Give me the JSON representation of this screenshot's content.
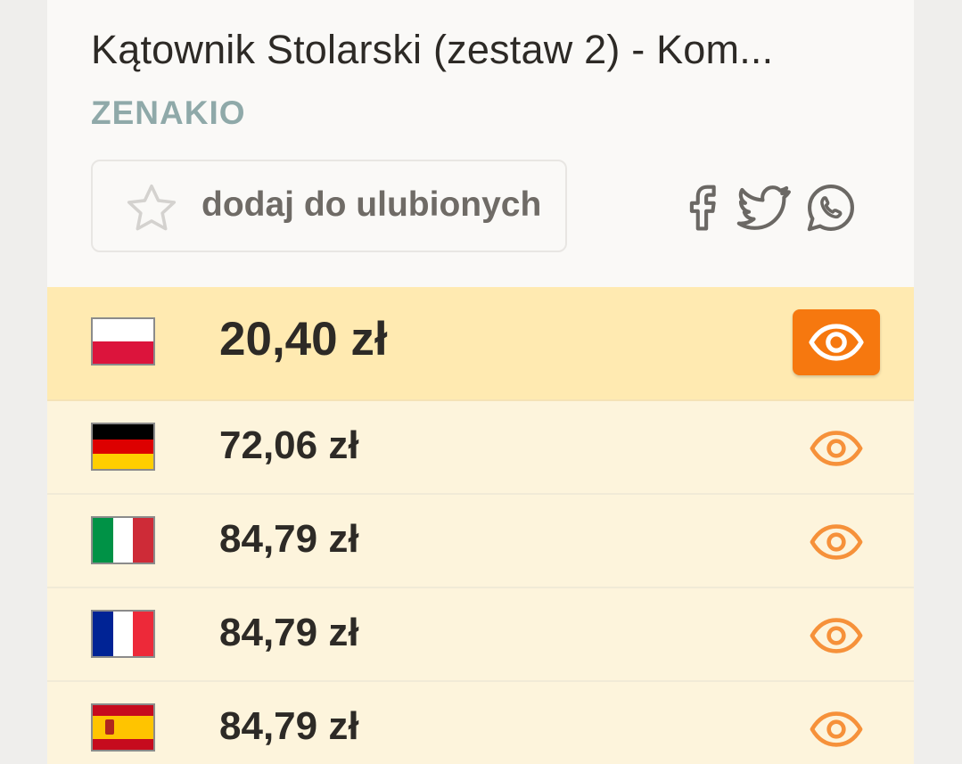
{
  "product": {
    "title": "Kątownik Stolarski (zestaw 2) - Kom...",
    "brand": "ZENAKIO"
  },
  "favorite": {
    "label": "dodaj do ulubionych",
    "icon": "star-icon"
  },
  "share": [
    {
      "icon": "facebook-icon"
    },
    {
      "icon": "twitter-icon"
    },
    {
      "icon": "whatsapp-icon"
    }
  ],
  "offers": [
    {
      "country": "Poland",
      "flag": "pl",
      "price": "20,40 zł",
      "best": true
    },
    {
      "country": "Germany",
      "flag": "de",
      "price": "72,06 zł",
      "best": false
    },
    {
      "country": "Italy",
      "flag": "it",
      "price": "84,79 zł",
      "best": false
    },
    {
      "country": "France",
      "flag": "fr",
      "price": "84,79 zł",
      "best": false
    },
    {
      "country": "Spain",
      "flag": "es",
      "price": "84,79 zł",
      "best": false
    }
  ],
  "colors": {
    "accent": "#f6780f",
    "best_row": "#ffeab1",
    "row": "#fdf4dc",
    "brand": "#8fa9a9"
  }
}
